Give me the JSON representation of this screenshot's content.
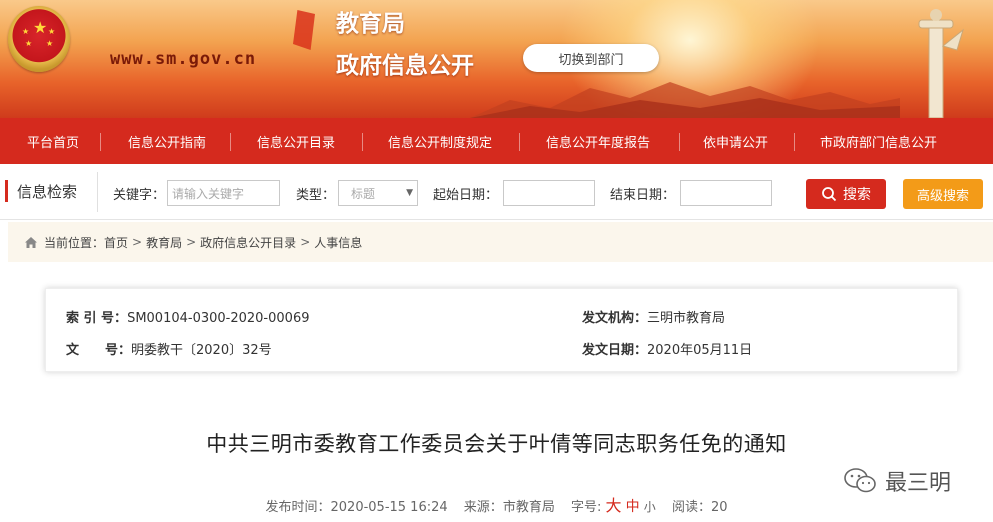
{
  "header": {
    "site_url": "www.sm.gov.cn",
    "bureau_name": "教育局",
    "bureau_sub": "政府信息公开",
    "switch_label": "切换到部门"
  },
  "nav": {
    "items": [
      {
        "label": "平台首页"
      },
      {
        "label": "信息公开指南"
      },
      {
        "label": "信息公开目录"
      },
      {
        "label": "信息公开制度规定"
      },
      {
        "label": "信息公开年度报告"
      },
      {
        "label": "依申请公开"
      },
      {
        "label": "市政府部门信息公开"
      }
    ]
  },
  "search": {
    "title": "信息检索",
    "keyword_label": "关键字：",
    "keyword_placeholder": "请输入关键字",
    "type_label": "类型：",
    "type_selected": "标题",
    "start_label": "起始日期：",
    "end_label": "结束日期：",
    "search_button": "搜索",
    "advanced_button": "高级搜索"
  },
  "breadcrumb": {
    "prefix": "当前位置：",
    "items": [
      "首页",
      "教育局",
      "政府信息公开目录",
      "人事信息"
    ],
    "sep": ">"
  },
  "meta": {
    "index_key": "索 引 号：",
    "index_value": "SM00104-0300-2020-00069",
    "doc_key": "文　　号：",
    "doc_value": "明委教干〔2020〕32号",
    "org_key": "发文机构：",
    "org_value": "三明市教育局",
    "date_key": "发文日期：",
    "date_value": "2020年05月11日"
  },
  "article": {
    "title": "中共三明市委教育工作委员会关于叶倩等同志职务任免的通知",
    "publish_label": "发布时间：",
    "publish_time": "2020-05-15 16:24",
    "source_label": "来源：",
    "source_value": "市教育局",
    "size_label": "字号:",
    "size_big": "大",
    "size_mid": "中",
    "size_small": "小",
    "read_label": "阅读：",
    "read_count": "20"
  },
  "watermark": {
    "text": "最三明",
    "icon": "wechat-icon"
  },
  "colors": {
    "primary_red": "#d52a1e",
    "accent_orange": "#f39b18"
  }
}
